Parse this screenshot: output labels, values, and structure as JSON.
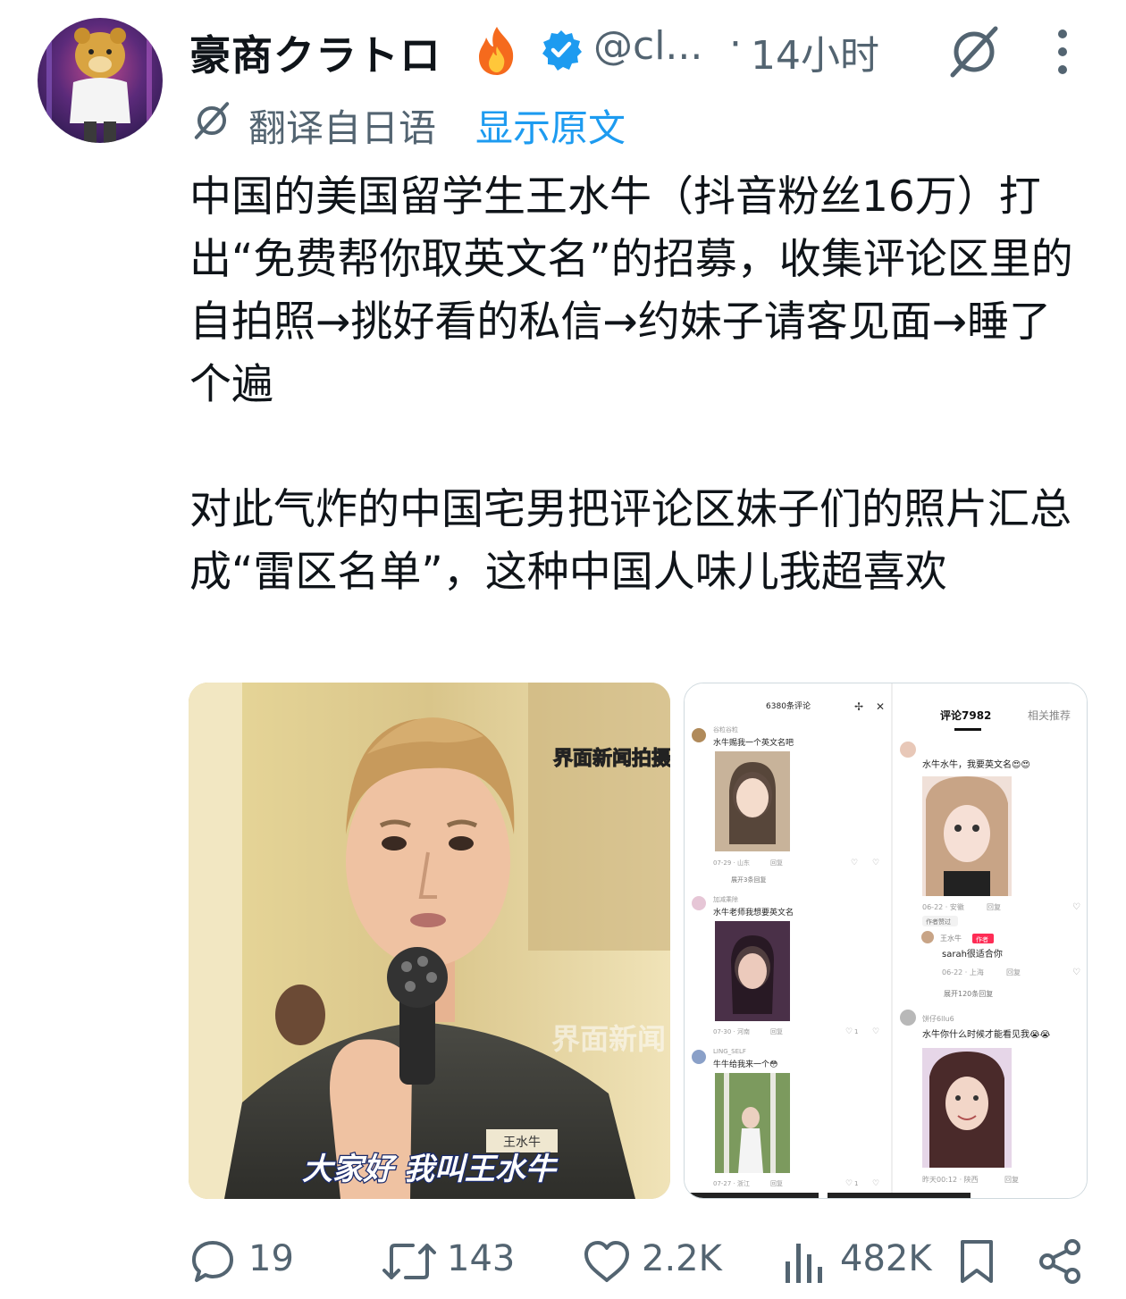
{
  "tweet": {
    "author_name": "豪商クラトロ",
    "handle": "@cl...",
    "separator": "·",
    "time": "14小时",
    "translation_label": "翻译自日语",
    "show_original": "显示原文",
    "paragraph1": "中国的美国留学生王水牛（抖音粉丝16万）打出“免费帮你取英文名”的招募，收集评论区里的自拍照→挑好看的私信→约妹子请客见面→睡了个遍",
    "paragraph2": "对此气炸的中国宅男把评论区妹子们的照片汇总成“雷区名单”，这种中国人味儿我超喜欢",
    "colors": {
      "accent": "#1d9bf0",
      "secondary_text": "#536471"
    }
  },
  "media_left": {
    "watermark_top": "界面新闻拍摄",
    "watermark_center": "界面新闻",
    "name_tag": "王水牛",
    "subtitle": "大家好 我叫王水牛"
  },
  "media_right": {
    "left_panel": {
      "header": "6380条评论",
      "comments": [
        {
          "user": "谷粒谷粒",
          "text": "水牛赐我一个英文名吧",
          "meta": "07-29 · 山东",
          "reply": "回复",
          "expand": "展开3条回复"
        },
        {
          "user": "加减乘除",
          "text": "水牛老师我想要英文名",
          "meta": "07-30 · 河南",
          "reply": "回复",
          "likes": "1"
        },
        {
          "user": "LING_SELF",
          "text": "牛牛给我来一个😳",
          "meta": "07-27 · 浙江",
          "reply": "回复",
          "likes": "1"
        }
      ]
    },
    "right_panel": {
      "tab_comments": "评论7982",
      "tab_related": "相关推荐",
      "comments": [
        {
          "text": "水牛水牛，我要英文名😍😍",
          "meta": "06-22 · 安徽",
          "reply": "回复",
          "badge": "作者赞过"
        },
        {
          "user": "王水牛",
          "author_tag": "作者",
          "text": "sarah很适合你",
          "meta": "06-22 · 上海",
          "reply": "回复",
          "expand": "展开120条回复"
        },
        {
          "user": "饼仔6llu6",
          "text": "水牛你什么时候才能看见我😭😭",
          "meta": "昨天00:12 · 陕西",
          "reply": "回复"
        }
      ]
    }
  },
  "actions": {
    "replies": "19",
    "reposts": "143",
    "likes": "2.2K",
    "views": "482K"
  }
}
